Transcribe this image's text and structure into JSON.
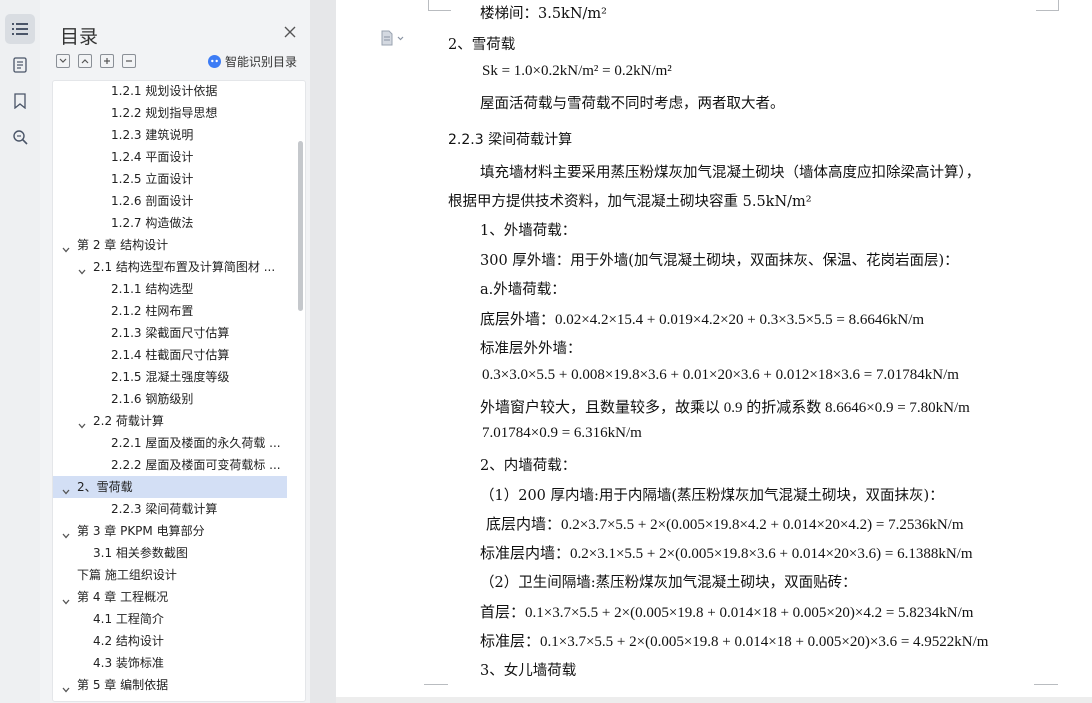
{
  "toc": {
    "title": "目录",
    "smart_label": "智能识别目录",
    "items": [
      {
        "label": "1.2.1 规划设计依据"
      },
      {
        "label": "1.2.2 规划指导思想"
      },
      {
        "label": "1.2.3 建筑说明"
      },
      {
        "label": "1.2.4 平面设计"
      },
      {
        "label": "1.2.5 立面设计"
      },
      {
        "label": "1.2.6 剖面设计"
      },
      {
        "label": "1.2.7 构造做法"
      },
      {
        "label": "第 2 章 结构设计"
      },
      {
        "label": "2.1 结构选型布置及计算简图材 ..."
      },
      {
        "label": "2.1.1 结构选型"
      },
      {
        "label": "2.1.2 柱网布置"
      },
      {
        "label": "2.1.3 梁截面尺寸估算"
      },
      {
        "label": "2.1.4 柱截面尺寸估算"
      },
      {
        "label": "2.1.5 混凝土强度等级"
      },
      {
        "label": "2.1.6 钢筋级别"
      },
      {
        "label": "2.2 荷载计算"
      },
      {
        "label": "2.2.1 屋面及楼面的永久荷载 ..."
      },
      {
        "label": "2.2.2 屋面及楼面可变荷载标 ..."
      },
      {
        "label": "2、雪荷载"
      },
      {
        "label": "2.2.3 梁间荷载计算"
      },
      {
        "label": "第 3 章 PKPM 电算部分"
      },
      {
        "label": "3.1 相关参数截图"
      },
      {
        "label": "下篇 施工组织设计"
      },
      {
        "label": "第 4 章 工程概况"
      },
      {
        "label": "4.1 工程简介"
      },
      {
        "label": "4.2 结构设计"
      },
      {
        "label": "4.3 装饰标准"
      },
      {
        "label": "第 5 章 编制依据"
      }
    ]
  },
  "doc": {
    "l0": "楼梯间：3.5kN/m²",
    "l1": "2、雪荷载",
    "l2": "Sk = 1.0×0.2kN/m² = 0.2kN/m²",
    "l3": "屋面活荷载与雪荷载不同时考虑，两者取大者。",
    "l4": "2.2.3 梁间荷载计算",
    "l5": "填充墙材料主要采用蒸压粉煤灰加气混凝土砌块（墙体高度应扣除梁高计算），",
    "l6": "根据甲方提供技术资料，加气混凝土砌块容重 5.5kN/m²",
    "l7": "1、外墙荷载：",
    "l8": "300 厚外墙：用于外墙(加气混凝土砌块，双面抹灰、保温、花岗岩面层)：",
    "l9": "a.外墙荷载：",
    "l10": "底层外墙：0.02×4.2×15.4 + 0.019×4.2×20 + 0.3×3.5×5.5 = 8.6646kN/m",
    "l11": "标准层外外墙：",
    "l12": "0.3×3.0×5.5 + 0.008×19.8×3.6 + 0.01×20×3.6 + 0.012×18×3.6 = 7.01784kN/m",
    "l13": "外墙窗户较大，且数量较多，故乘以 0.9 的折减系数 8.6646×0.9 = 7.80kN/m",
    "l14": "7.01784×0.9 = 6.316kN/m",
    "l15": "2、内墙荷载：",
    "l16": "（1）200 厚内墙:用于内隔墙(蒸压粉煤灰加气混凝土砌块，双面抹灰)：",
    "l17": "底层内墙：0.2×3.7×5.5 + 2×(0.005×19.8×4.2 + 0.014×20×4.2) = 7.2536kN/m",
    "l18": "标准层内墙：0.2×3.1×5.5 + 2×(0.005×19.8×3.6 + 0.014×20×3.6) = 6.1388kN/m",
    "l19": "（2）卫生间隔墙:蒸压粉煤灰加气混凝土砌块，双面贴砖：",
    "l20": "首层：0.1×3.7×5.5 + 2×(0.005×19.8 + 0.014×18 + 0.005×20)×4.2 = 5.8234kN/m",
    "l21": "标准层：0.1×3.7×5.5 + 2×(0.005×19.8 + 0.014×18 + 0.005×20)×3.6 = 4.9522kN/m",
    "l22": "3、女儿墙荷载"
  }
}
